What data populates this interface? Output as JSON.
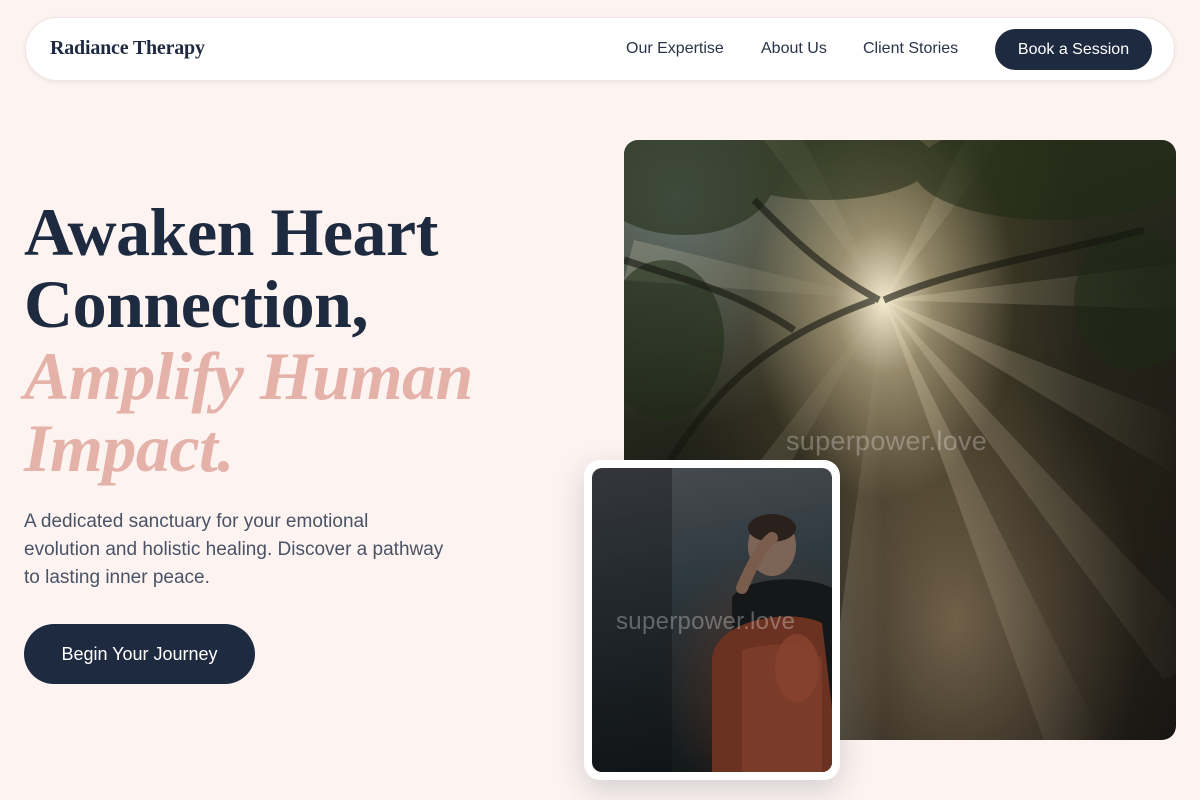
{
  "brand": {
    "name": "Radiance Therapy"
  },
  "nav": {
    "links": [
      "Our Expertise",
      "About Us",
      "Client Stories"
    ],
    "cta_label": "Book a Session"
  },
  "hero": {
    "headline_line1": "Awaken Heart",
    "headline_line2": "Connection,",
    "accent_line1": "Amplify Human",
    "accent_line2": "Impact.",
    "subtext": "A dedicated sanctuary for your emotional evolution and holistic healing. Discover a pathway to lasting inner peace.",
    "cta_label": "Begin Your Journey"
  },
  "images": {
    "main_watermark": "superpower.love",
    "card_watermark": "superpower.love"
  },
  "colors": {
    "background": "#fdf3f1",
    "navy": "#1e2a3f",
    "accent_rose": "#e4b2a9",
    "body_text": "#4a5366"
  }
}
